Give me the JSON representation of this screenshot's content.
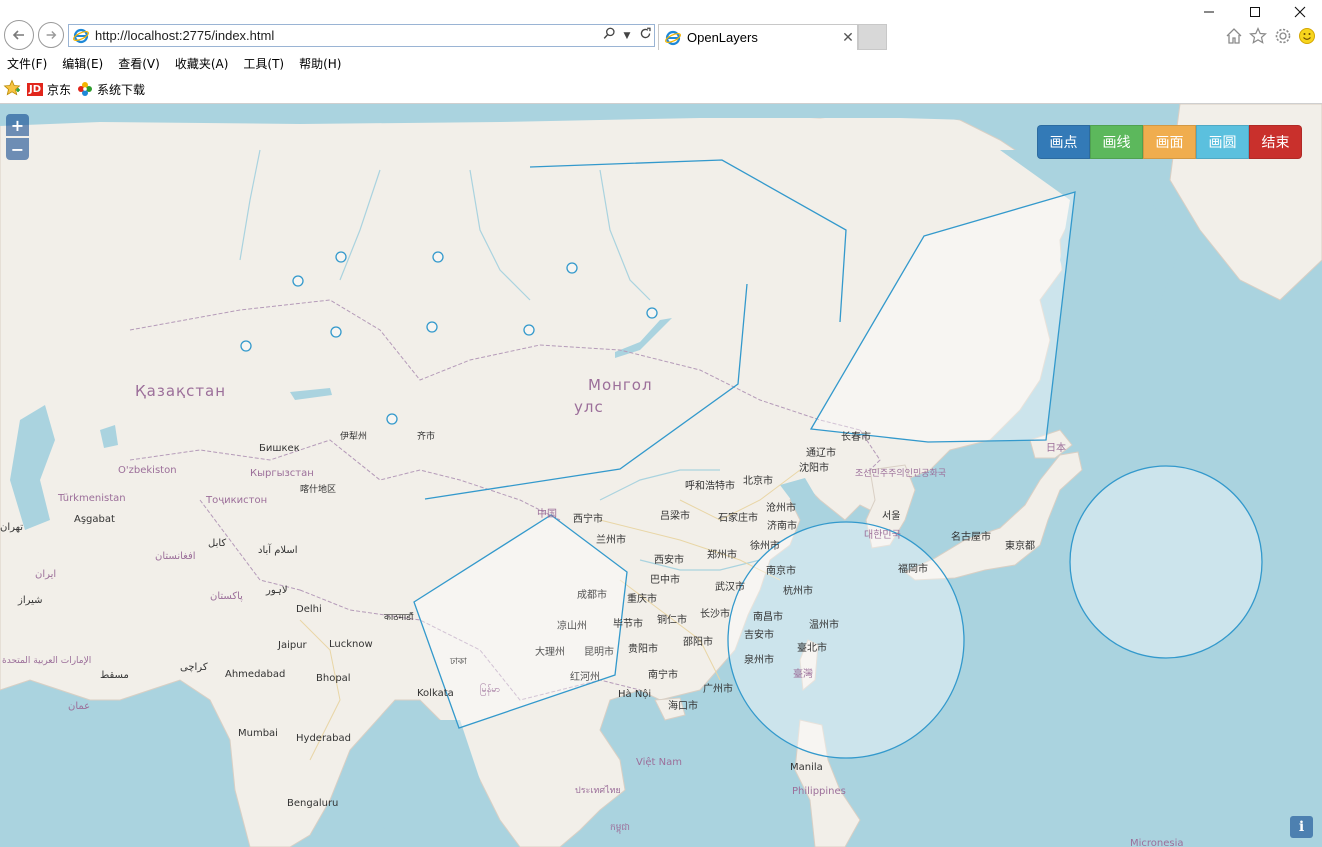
{
  "window": {
    "minimize": "—",
    "maximize": "☐",
    "close": "✕"
  },
  "nav": {
    "back_icon": "arrow-left-icon",
    "forward_icon": "arrow-right-icon"
  },
  "address": {
    "url": "http://localhost:2775/index.html"
  },
  "tab": {
    "title": "OpenLayers",
    "close": "✕"
  },
  "toolbar_icons": [
    "home-icon",
    "star-icon",
    "gear-icon",
    "smiley-icon"
  ],
  "menu": [
    {
      "label": "文件(F)"
    },
    {
      "label": "编辑(E)"
    },
    {
      "label": "查看(V)"
    },
    {
      "label": "收藏夹(A)"
    },
    {
      "label": "工具(T)"
    },
    {
      "label": "帮助(H)"
    }
  ],
  "favorites": [
    {
      "label": "京东",
      "badge": "JD"
    },
    {
      "label": "系统下载"
    }
  ],
  "map_controls": {
    "zoom_in": "+",
    "zoom_out": "−",
    "info": "i"
  },
  "draw_buttons": [
    {
      "label": "画点",
      "color": "#337ab7"
    },
    {
      "label": "画线",
      "color": "#5cb85c"
    },
    {
      "label": "画面",
      "color": "#f0ad4e"
    },
    {
      "label": "画圆",
      "color": "#5bc0de"
    },
    {
      "label": "结束",
      "color": "#c9302c"
    }
  ],
  "map_labels": {
    "kazakhstan": "Қазақстан",
    "mongolia_1": "Монгол",
    "mongolia_2": "улс",
    "bishkek": "Бишкек",
    "kyrgyzstan": "Кыргызстан",
    "uzbekistan": "O'zbekiston",
    "turkmenistan": "Türkmenistan",
    "tajikistan": "Тоҷикистон",
    "ashgabat": "Aşgabat",
    "kashgar": "喀什地区",
    "yili": "伊犁州",
    "qitai": "齐市",
    "afghanistan": "افغانستان",
    "pakistan": "پاکستان",
    "iran": "ایران",
    "delhi": "Delhi",
    "lucknow": "Lucknow",
    "jaipur": "Jaipur",
    "ahmedabad": "Ahmedabad",
    "bhopal": "Bhopal",
    "mumbai": "Mumbai",
    "hyderabad": "Hyderabad",
    "bengaluru": "Bengaluru",
    "kolkata": "Kolkata",
    "china": "中国",
    "xining": "西宁市",
    "lanzhou": "兰州市",
    "hohhot": "呼和浩特市",
    "beijing": "北京市",
    "changchun": "长春市",
    "tonghua": "通辽市",
    "shenyang": "沈阳市",
    "shijiazhuang": "石家庄市",
    "cangzhou": "沧州市",
    "jinan": "济南市",
    "xuzhou": "徐州市",
    "liangliang": "吕梁市",
    "xian": "西安市",
    "zhengzhou": "郑州市",
    "chengdu": "成都市",
    "bazhong": "巴中市",
    "chongqing": "重庆市",
    "wuhan": "武汉市",
    "nanjing": "南京市",
    "hangzhou": "杭州市",
    "nanchang": "南昌市",
    "wenzhou": "温州市",
    "jian": "吉安市",
    "taibei": "臺北市",
    "quanzhou": "泉州市",
    "taiwan": "臺灣",
    "tongren": "铜仁市",
    "changsha": "长沙市",
    "shaoyang": "邵阳市",
    "bijie": "毕节市",
    "guiyang": "贵阳市",
    "liangshan": "凉山州",
    "dali": "大理州",
    "kunming": "昆明市",
    "honghe": "红河州",
    "nanning": "南宁市",
    "guangzhou": "广州市",
    "haikou": "海口市",
    "hanoi": "Hà Nội",
    "vietnam": "Việt Nam",
    "north_korea": "조선민주주의인민공화국",
    "seoul": "서울",
    "south_korea": "대한민국",
    "fukuoka": "福岡市",
    "nagoya": "名古屋市",
    "tokyo": "東京都",
    "japan": "日本",
    "manila": "Manila",
    "philippines": "Philippines",
    "micronesia": "Micronesia",
    "uae": "الإمارات العربية المتحدة",
    "muscat": "مسقط",
    "oman": "عمان",
    "karachi": "کراچی",
    "lahore": "لاہور",
    "kabul": "کابل",
    "islamabad": "اسلام آباد",
    "shiraz": "شیراز",
    "tehran": "تهران",
    "kathmandu": "काठमाडौं",
    "dhaka": "ঢাকা",
    "myanmar": "မြန်မာ",
    "thailand": "ประเทศไทย",
    "cambodia": "កម្ពុជា"
  }
}
